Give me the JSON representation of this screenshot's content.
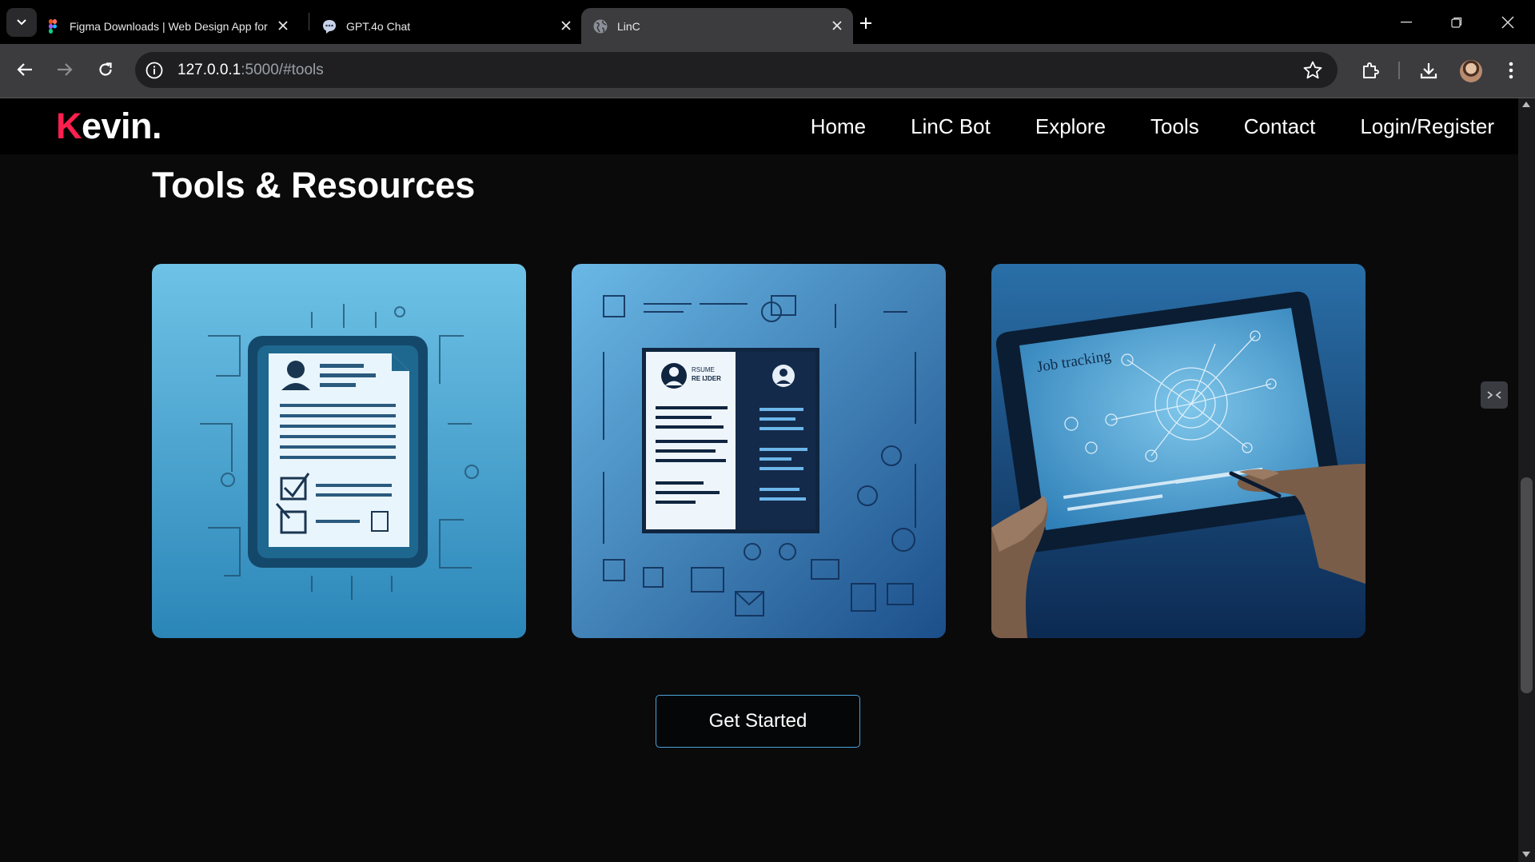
{
  "browser": {
    "tabs": [
      {
        "title": "Figma Downloads | Web Design App for D",
        "favicon": "figma-icon",
        "active": false
      },
      {
        "title": "GPT.4o Chat",
        "favicon": "chat-bubble-icon",
        "active": false
      },
      {
        "title": "LinC",
        "favicon": "globe-icon",
        "active": true
      }
    ],
    "url_host": "127.0.0.1",
    "url_path": ":5000/#tools"
  },
  "site": {
    "logo_first": "K",
    "logo_rest": "evin.",
    "nav": [
      "Home",
      "LinC Bot",
      "Explore",
      "Tools",
      "Contact",
      "Login/Register"
    ]
  },
  "main": {
    "section_title": "Tools & Resources",
    "cards": [
      {
        "illustration": "resume-document-illustration"
      },
      {
        "illustration": "resume-builder-illustration",
        "text_1": "RSUME",
        "text_2": "RE IJDER"
      },
      {
        "illustration": "job-tracking-tablet-illustration",
        "text": "Job tracking"
      }
    ],
    "cta_label": "Get Started"
  },
  "colors": {
    "accent_red": "#ff1f4f",
    "cta_border": "#4aa3d8",
    "page_bg": "#0a0a0b"
  }
}
